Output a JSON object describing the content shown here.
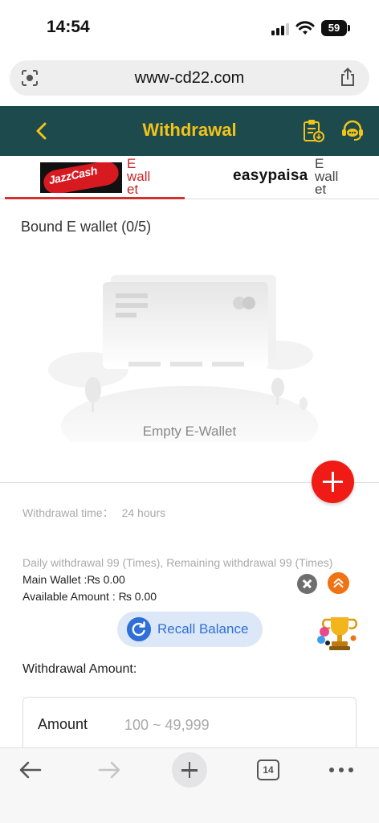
{
  "status_bar": {
    "time": "14:54",
    "battery": "59"
  },
  "browser": {
    "url": "www-cd22.com",
    "tab_count": "14"
  },
  "header": {
    "title": "Withdrawal"
  },
  "tabs": [
    {
      "logo_text": "JazzCash",
      "label": "E wall et"
    },
    {
      "logo_text": "easypaisa",
      "label": "E wall et"
    }
  ],
  "bound_title": "Bound E wallet (0/5)",
  "empty_text": "Empty E-Wallet",
  "withdrawal_time": {
    "label": "Withdrawal time：",
    "value": "24 hours"
  },
  "daily_info": "Daily withdrawal 99 (Times), Remaining withdrawal 99 (Times)",
  "main_wallet": "Main Wallet :₨ 0.00",
  "available_amount": "Available Amount : ₨ 0.00",
  "recall_label": "Recall Balance",
  "amount_section": {
    "title": "Withdrawal Amount:",
    "label": "Amount",
    "placeholder": "100 ~ 49,999"
  },
  "colors": {
    "header_bg": "#1d4a4d",
    "title": "#f2c318",
    "accent_red": "#f01b14",
    "recall_blue": "#2f6fd8"
  },
  "icons": [
    "back-icon",
    "records-icon",
    "support-icon",
    "add-icon",
    "close-icon",
    "chevron-up-icon",
    "refresh-icon",
    "trophy-icon"
  ]
}
